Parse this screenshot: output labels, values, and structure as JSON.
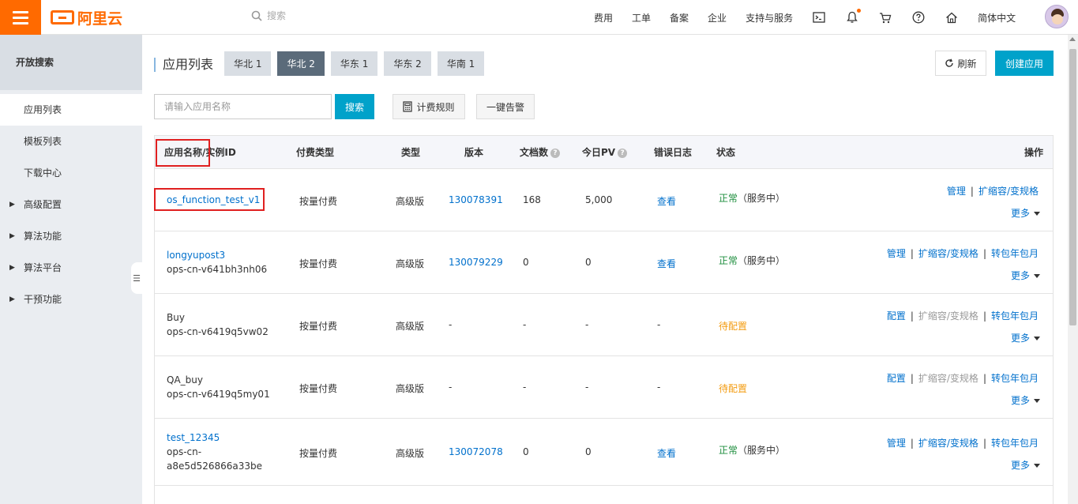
{
  "topbar": {
    "brand": "阿里云",
    "search_placeholder": "搜索",
    "nav": [
      "费用",
      "工单",
      "备案",
      "企业",
      "支持与服务"
    ],
    "language": "简体中文",
    "accent_color": "#ff6a00"
  },
  "sidebar": {
    "title": "开放搜索",
    "items": [
      {
        "label": "应用列表",
        "active": true
      },
      {
        "label": "模板列表"
      },
      {
        "label": "下载中心"
      },
      {
        "label": "高级配置",
        "expandable": true
      },
      {
        "label": "算法功能",
        "expandable": true
      },
      {
        "label": "算法平台",
        "expandable": true
      },
      {
        "label": "干预功能",
        "expandable": true
      }
    ]
  },
  "main": {
    "title": "应用列表",
    "regions": [
      "华北 1",
      "华北 2",
      "华东 1",
      "华东 2",
      "华南 1"
    ],
    "active_region": "华北 2",
    "refresh_label": "刷新",
    "create_label": "创建应用",
    "search_placeholder": "请输入应用名称",
    "search_button": "搜索",
    "billing_button": "计费规则",
    "alarm_button": "一键告警"
  },
  "table": {
    "headers": {
      "name": "应用名称/实例ID",
      "pay_type": "付费类型",
      "type": "类型",
      "version": "版本",
      "docs": "文档数",
      "pv": "今日PV",
      "error_log": "错误日志",
      "status": "状态",
      "ops": "操作"
    },
    "rows": [
      {
        "name": "os_function_test_v1",
        "instance": "",
        "pay_type": "按量付费",
        "type": "高级版",
        "version": "130078391",
        "docs": "168",
        "pv": "5,000",
        "log": "查看",
        "status": "正常",
        "status_note": "（服务中）",
        "op1": "管理",
        "op2": "扩缩容/变规格",
        "op3": "",
        "more": "更多"
      },
      {
        "name": "longyupost3",
        "instance": "ops-cn-v641bh3nh06",
        "pay_type": "按量付费",
        "type": "高级版",
        "version": "130079229",
        "docs": "0",
        "pv": "0",
        "log": "查看",
        "status": "正常",
        "status_note": "（服务中）",
        "op1": "管理",
        "op2": "扩缩容/变规格",
        "op3": "转包年包月",
        "more": "更多"
      },
      {
        "name": "Buy",
        "instance": "ops-cn-v6419q5vw02",
        "pay_type": "按量付费",
        "type": "高级版",
        "version": "-",
        "docs": "-",
        "pv": "-",
        "log": "-",
        "status": "待配置",
        "status_note": "",
        "op1": "配置",
        "op2": "扩缩容/变规格",
        "op3": "转包年包月",
        "more": "更多"
      },
      {
        "name": "QA_buy",
        "instance": "ops-cn-v6419q5my01",
        "pay_type": "按量付费",
        "type": "高级版",
        "version": "-",
        "docs": "-",
        "pv": "-",
        "log": "-",
        "status": "待配置",
        "status_note": "",
        "op1": "配置",
        "op2": "扩缩容/变规格",
        "op3": "转包年包月",
        "more": "更多"
      },
      {
        "name": "test_12345",
        "instance_a": "ops-cn-",
        "instance_b": "a8e5d526866a33be",
        "pay_type": "按量付费",
        "type": "高级版",
        "version": "130072078",
        "docs": "0",
        "pv": "0",
        "log": "查看",
        "status": "正常",
        "status_note": "（服务中）",
        "op1": "管理",
        "op2": "扩缩容/变规格",
        "op3": "转包年包月",
        "more": "更多"
      }
    ]
  }
}
